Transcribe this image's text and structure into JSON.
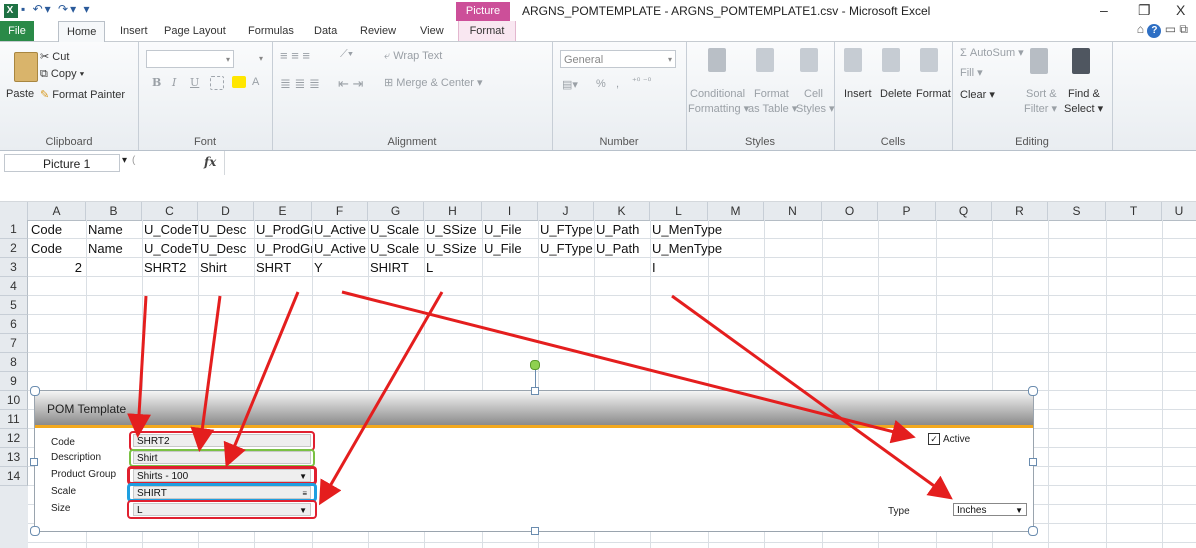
{
  "window": {
    "title": "ARGNS_POMTEMPLATE - ARGNS_POMTEMPLATE1.csv - Microsoft Excel",
    "context_tab": "Picture Tools",
    "minimize": "–",
    "restore": "❐",
    "close": "X"
  },
  "tabs": [
    "File",
    "Home",
    "Insert",
    "Page Layout",
    "Formulas",
    "Data",
    "Review",
    "View",
    "Format"
  ],
  "ribbon": {
    "clipboard": {
      "paste": "Paste",
      "cut": "Cut",
      "copy": "Copy ▾",
      "format_painter": "Format Painter",
      "label": "Clipboard"
    },
    "font": {
      "label": "Font",
      "bold": "B",
      "italic": "I",
      "underline": "U",
      "grow": "A˄",
      "shrink": "A˅",
      "color": "A"
    },
    "alignment": {
      "wrap": "Wrap Text",
      "merge": "Merge & Center",
      "label": "Alignment"
    },
    "number": {
      "format": "General",
      "label": "Number",
      "percent": "%",
      "comma": ","
    },
    "styles": {
      "conditional": "Conditional",
      "conditional2": "Formatting ▾",
      "format_table": "Format",
      "format_table2": "as Table ▾",
      "cell": "Cell",
      "cell2": "Styles ▾",
      "label": "Styles"
    },
    "cells": {
      "insert": "Insert",
      "delete": "Delete",
      "format": "Format",
      "label": "Cells"
    },
    "editing": {
      "autosum": "Σ AutoSum ▾",
      "fill": "Fill ▾",
      "clear": "Clear ▾",
      "sort": "Sort &",
      "sort2": "Filter ▾",
      "find": "Find &",
      "find2": "Select ▾",
      "label": "Editing"
    }
  },
  "formula_bar": {
    "name_box": "Picture 1",
    "fx": "fx"
  },
  "columns": [
    "A",
    "B",
    "C",
    "D",
    "E",
    "F",
    "G",
    "H",
    "I",
    "J",
    "K",
    "L",
    "M",
    "N",
    "O",
    "P",
    "Q",
    "R",
    "S",
    "T",
    "U"
  ],
  "rows": [
    "1",
    "2",
    "3",
    "4",
    "5",
    "6",
    "7",
    "8",
    "9",
    "10",
    "11",
    "12",
    "13",
    "14"
  ],
  "cells": {
    "r1": [
      "Code",
      "Name",
      "U_CodeTn",
      "U_Desc",
      "U_ProdGr",
      "U_Active",
      "U_Scale",
      "U_SSize",
      "U_File",
      "U_FType",
      "U_Path",
      "U_MenType"
    ],
    "r2": [
      "Code",
      "Name",
      "U_CodeTn",
      "U_Desc",
      "U_ProdGr",
      "U_Active",
      "U_Scale",
      "U_SSize",
      "U_File",
      "U_FType",
      "U_Path",
      "U_MenType"
    ],
    "r3": {
      "A": "2",
      "C": "SHRT2",
      "D": "Shirt",
      "E": "SHRT",
      "F": "Y",
      "G": "SHIRT",
      "H": "L",
      "L": "I"
    }
  },
  "pom_form": {
    "title": "POM Template",
    "labels": {
      "code": "Code",
      "description": "Description",
      "product_group": "Product Group",
      "scale": "Scale",
      "size": "Size",
      "type": "Type",
      "active": "Active"
    },
    "values": {
      "code": "SHRT2",
      "description": "Shirt",
      "product_group": "Shirts - 100",
      "scale": "SHIRT",
      "size": "L",
      "type": "Inches"
    },
    "active_checked": true
  },
  "colors": {
    "accent_red": "#e41e1e",
    "excel_green": "#2a8a48",
    "picture_tools": "#cc4f99",
    "orange_bar": "#f2a81d",
    "hl_green": "#7ac143",
    "hl_blue": "#1e9fe0",
    "hl_red": "#e0202f"
  }
}
